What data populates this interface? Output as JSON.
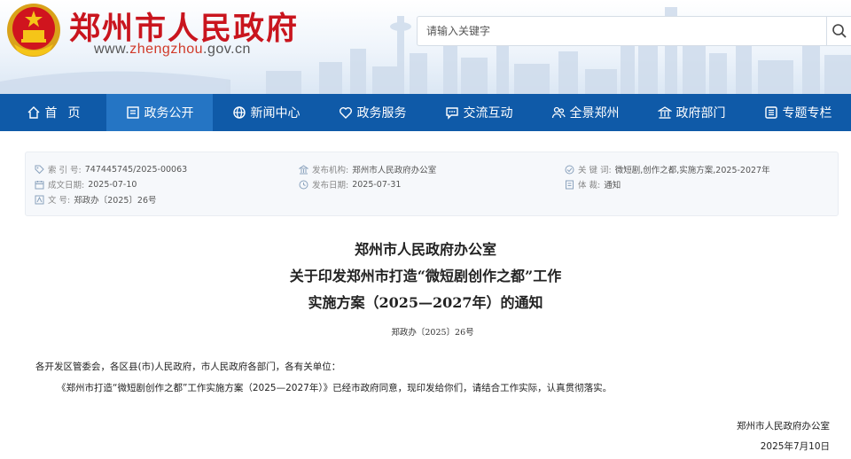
{
  "header": {
    "site_title": "郑州市人民政府",
    "url_prefix": "www.",
    "url_highlight": "zhengzhou",
    "url_suffix": ".gov.cn",
    "search_placeholder": "请输入关键字",
    "search_icon": "search-icon"
  },
  "nav": {
    "items": [
      {
        "label": "首页",
        "icon": "home-icon"
      },
      {
        "label": "政务公开",
        "icon": "document-icon"
      },
      {
        "label": "新闻中心",
        "icon": "globe-icon"
      },
      {
        "label": "政务服务",
        "icon": "heart-icon"
      },
      {
        "label": "交流互动",
        "icon": "chat-icon"
      },
      {
        "label": "全景郑州",
        "icon": "people-icon"
      },
      {
        "label": "政府部门",
        "icon": "building-icon"
      },
      {
        "label": "专题专栏",
        "icon": "list-icon"
      }
    ],
    "active_index": 1,
    "colors": {
      "bar": "#0f5aa8",
      "active": "#2575c4"
    }
  },
  "meta": {
    "index_key": "索 引 号:",
    "index_val": "747445745/2025-00063",
    "date_created_key": "成文日期:",
    "date_created_val": "2025-07-10",
    "doc_no_key": "文      号:",
    "doc_no_val": "郑政办〔2025〕26号",
    "issuer_key": "发布机构:",
    "issuer_val": "郑州市人民政府办公室",
    "publish_key": "发布日期:",
    "publish_val": "2025-07-31",
    "keywords_key": "关 键 词:",
    "keywords_val": "微短剧,创作之都,实施方案,2025-2027年",
    "genre_key": "体      裁:",
    "genre_val": "通知"
  },
  "document": {
    "title_line1": "郑州市人民政府办公室",
    "title_line2": "关于印发郑州市打造“微短剧创作之都”工作",
    "title_line3": "实施方案（2025—2027年）的通知",
    "doc_number": "郑政办〔2025〕26号",
    "salutation": "各开发区管委会，各区县(市)人民政府，市人民政府各部门，各有关单位：",
    "body": "《郑州市打造“微短剧创作之都”工作实施方案（2025—2027年）》已经市政府同意，现印发给你们，请结合工作实际，认真贯彻落实。",
    "signature": "郑州市人民政府办公室",
    "sign_date": "2025年7月10日"
  }
}
